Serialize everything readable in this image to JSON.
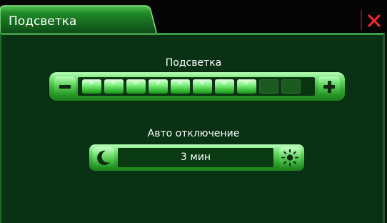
{
  "window": {
    "title": "Подсветка"
  },
  "backlight": {
    "label": "Подсветка",
    "level": 8,
    "max_level": 10
  },
  "auto_off": {
    "label": "Авто отключение",
    "value": "3 мин"
  },
  "icons": {
    "close": "close-icon",
    "minus": "minus-icon",
    "plus": "plus-icon",
    "moon": "moon-icon",
    "sun": "sun-icon"
  },
  "colors": {
    "accent_green": "#4fd04f",
    "panel_bg": "#093113",
    "close_red": "#ff2a2a"
  }
}
